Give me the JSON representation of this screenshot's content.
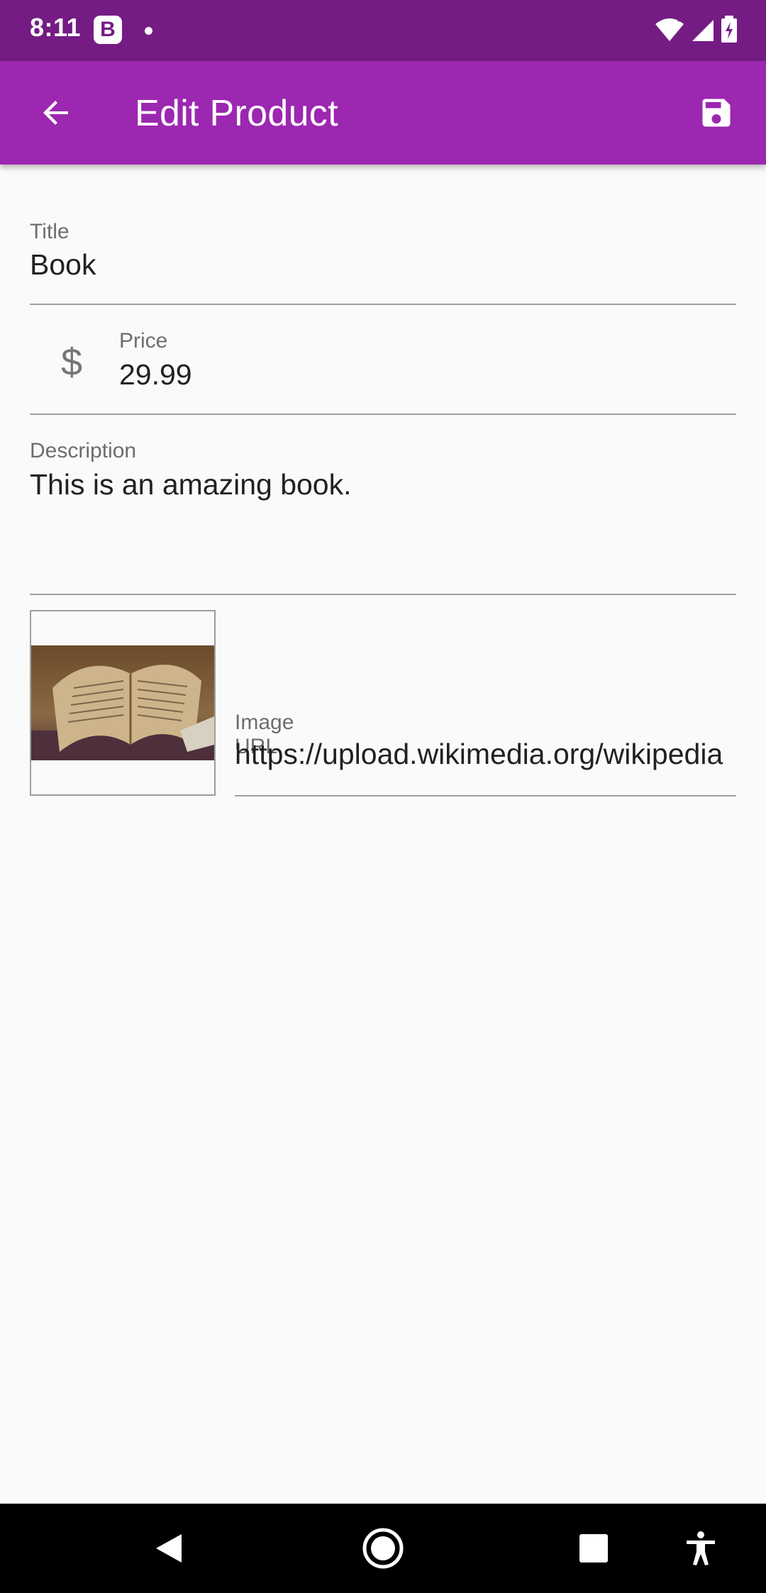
{
  "status_bar": {
    "time": "8:11",
    "badge_letter": "B"
  },
  "app_bar": {
    "title": "Edit Product",
    "back_icon": "arrow-back-icon",
    "save_icon": "save-icon",
    "color": "#9c27b0"
  },
  "form": {
    "title": {
      "label": "Title",
      "value": "Book"
    },
    "price": {
      "label": "Price",
      "value": "29.99",
      "icon": "$"
    },
    "description": {
      "label": "Description",
      "value": "This is an amazing book."
    },
    "image_url": {
      "label": "Image URL",
      "value": "https://upload.wikimedia.org/wikipedia"
    }
  },
  "nav_bar": {
    "icons": [
      "back-triangle-icon",
      "home-circle-icon",
      "recents-square-icon",
      "accessibility-icon"
    ]
  }
}
